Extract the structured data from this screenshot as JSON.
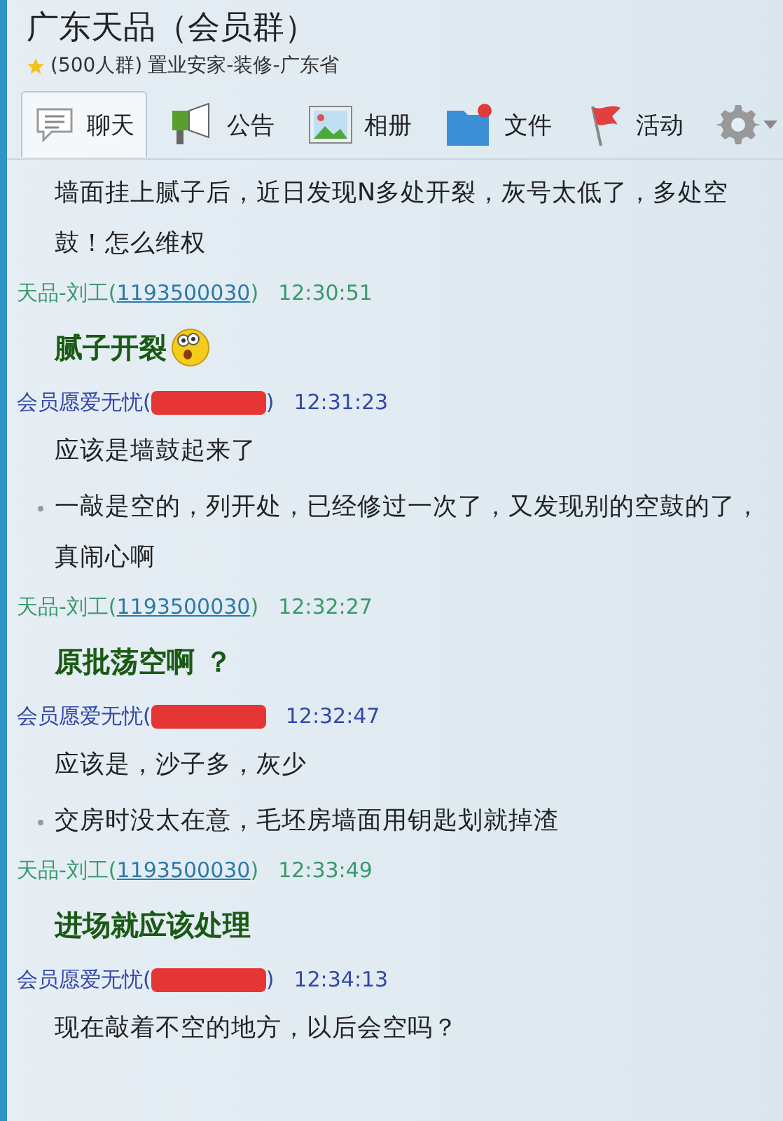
{
  "window": {
    "title": "广东天品（会员群）",
    "starred": true,
    "subtitle_count": "(500人群)",
    "subtitle": "置业安家-装修-广东省"
  },
  "tabs": [
    {
      "label": "聊天",
      "selected": true
    },
    {
      "label": "公告",
      "selected": false
    },
    {
      "label": "相册",
      "selected": false
    },
    {
      "label": "文件",
      "selected": false
    },
    {
      "label": "活动",
      "selected": false
    }
  ],
  "messages": [
    {
      "kind": "text",
      "text": "墙面挂上腻子后，近日发现N多处开裂，灰号太低了，多处空鼓！怎么维权"
    },
    {
      "kind": "staff",
      "name": "天品-刘工",
      "open": "(",
      "id": "1193500030",
      "close": ")",
      "time": "12:30:51"
    },
    {
      "kind": "bold",
      "text": "腻子开裂",
      "emoji": true
    },
    {
      "kind": "member",
      "name": "会员愿爱无忧",
      "open": "(",
      "redacted": true,
      "close": ")",
      "time": "12:31:23"
    },
    {
      "kind": "text",
      "text": "应该是墙鼓起来了"
    },
    {
      "kind": "text",
      "text": "一敲是空的，列开处，已经修过一次了，又发现别的空鼓的了，真闹心啊",
      "bullet": true
    },
    {
      "kind": "staff",
      "name": "天品-刘工",
      "open": "(",
      "id": "1193500030",
      "close": ")",
      "time": "12:32:27"
    },
    {
      "kind": "bold",
      "text": "原批荡空啊 ？"
    },
    {
      "kind": "member",
      "name": "会员愿爱无忧",
      "open": "(",
      "redacted": true,
      "time": "12:32:47"
    },
    {
      "kind": "text",
      "text": "应该是，沙子多，灰少"
    },
    {
      "kind": "text",
      "text": "交房时没太在意，毛坯房墙面用钥匙划就掉渣",
      "bullet": true
    },
    {
      "kind": "staff",
      "name": "天品-刘工",
      "open": "(",
      "id": "1193500030",
      "close": ")",
      "time": "12:33:49"
    },
    {
      "kind": "bold",
      "text": "进场就应该处理"
    },
    {
      "kind": "member",
      "name": "会员愿爱无忧",
      "open": "(",
      "redacted": true,
      "close": ")",
      "time": "12:34:13"
    },
    {
      "kind": "text",
      "text": "现在敲着不空的地方，以后会空吗？"
    }
  ]
}
